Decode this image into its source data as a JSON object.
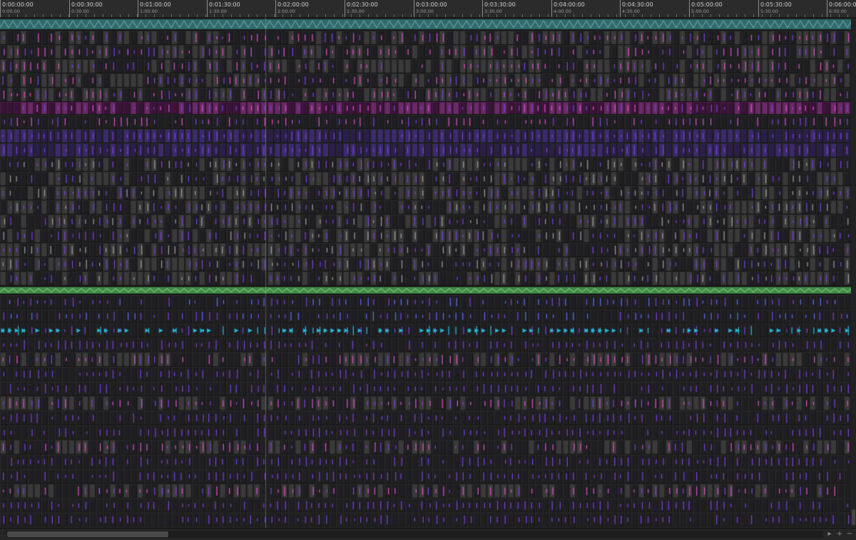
{
  "timeline": {
    "ticks": [
      {
        "main": "0:00:00:00",
        "sub": "0:00.00"
      },
      {
        "main": "0:00:30:00",
        "sub": "0:30.00"
      },
      {
        "main": "0:01:00:00",
        "sub": "1:00.00"
      },
      {
        "main": "0:01:30:00",
        "sub": "1:30.00"
      },
      {
        "main": "0:02:00:00",
        "sub": "2:00.00"
      },
      {
        "main": "0:02:30:00",
        "sub": "2:30.00"
      },
      {
        "main": "0:03:00:00",
        "sub": "3:00.00"
      },
      {
        "main": "0:03:30:00",
        "sub": "3:30.00"
      },
      {
        "main": "0:04:00:00",
        "sub": "4:00.00"
      },
      {
        "main": "0:04:30:00",
        "sub": "4:30.00"
      },
      {
        "main": "0:05:00:00",
        "sub": "5:00.00"
      },
      {
        "main": "0:05:30:00",
        "sub": "5:30.00"
      },
      {
        "main": "0:06:00:00",
        "sub": "6:00.00"
      }
    ]
  },
  "colors": {
    "background": "#232323",
    "clip_dark": "#1f1f23",
    "clip_gray": "#3a3a3a",
    "pink": "#d64fc4",
    "violet": "#7a3fd8",
    "magenta_band": "#4a1b48",
    "teal_automation": "#2f6b6b",
    "green_automation": "#3e8a43",
    "cyan_marker": "#27b8d8"
  },
  "controls": {
    "zoom_in": "+",
    "zoom_out": "−",
    "scroll_right": "▸"
  }
}
